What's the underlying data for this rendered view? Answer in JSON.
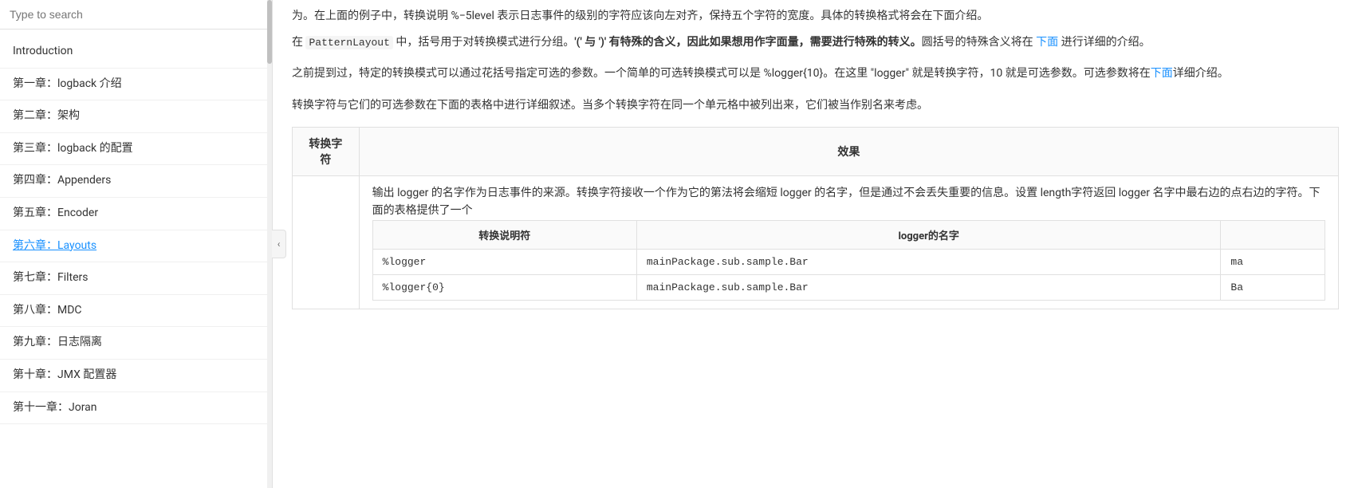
{
  "sidebar": {
    "search_placeholder": "Type to search",
    "nav_items": [
      {
        "id": "introduction",
        "label": "Introduction",
        "active": false
      },
      {
        "id": "chapter1",
        "label": "第一章：logback 介绍",
        "active": false
      },
      {
        "id": "chapter2",
        "label": "第二章：架构",
        "active": false
      },
      {
        "id": "chapter3",
        "label": "第三章：logback 的配置",
        "active": false
      },
      {
        "id": "chapter4",
        "label": "第四章：Appenders",
        "active": false
      },
      {
        "id": "chapter5",
        "label": "第五章：Encoder",
        "active": false
      },
      {
        "id": "chapter6",
        "label": "第六章：Layouts",
        "active": true
      },
      {
        "id": "chapter7",
        "label": "第七章：Filters",
        "active": false
      },
      {
        "id": "chapter8",
        "label": "第八章：MDC",
        "active": false
      },
      {
        "id": "chapter9",
        "label": "第九章：日志隔离",
        "active": false
      },
      {
        "id": "chapter10",
        "label": "第十章：JMX 配置器",
        "active": false
      },
      {
        "id": "chapter11",
        "label": "第十一章：Joran",
        "active": false
      }
    ],
    "collapse_icon": "‹"
  },
  "main": {
    "top_paragraph": "为。在上面的例子中，转换说明 %−5level 表示日志事件的级别的字符应该向左对齐，保持五个字符的宽度。具体的转换格式将会在下面介绍。",
    "paragraph1_prefix": "在 ",
    "paragraph1_code": "PatternLayout",
    "paragraph1_middle": " 中，括号用于对转换模式进行分组。",
    "paragraph1_bold": "'(' 与 ')' 有特殊的含义，因此如果想用作字面量，需要进行特殊的转义。",
    "paragraph1_suffix_prefix": "圆括号的特殊含义将在 ",
    "paragraph1_link1": "下面",
    "paragraph1_suffix": " 进行详细的介绍。",
    "paragraph2": "之前提到过，特定的转换模式可以通过花括号指定可选的参数。一个简单的可选转换模式可以是 %logger{10}。在这里 \"logger\" 就是转换字符，10 就是可选参数。可选参数将在",
    "paragraph2_link": "下面",
    "paragraph2_suffix": "详细介绍。",
    "paragraph3": "转换字符与它们的可选参数在下面的表格中进行详细叙述。当多个转换字符在同一个单元格中被列出来，它们被当作别名来考虑。",
    "table": {
      "header_col1": "转换字符",
      "header_col2": "效果",
      "row1_col2": "输出 logger 的名字作为日志事件的来源。转换字符接收一个作为它的第法将会缩短 logger 的名字，但是通过不会丢失重要的信息。设置 length字符返回 logger 名字中最右边的点右边的字符。下面的表格提供了一个",
      "inner_table": {
        "header_col1": "转换说明符",
        "header_col2": "logger的名字",
        "header_col3": "",
        "rows": [
          {
            "col1": "%logger",
            "col2": "mainPackage.sub.sample.Bar",
            "col3": "ma"
          },
          {
            "col1": "%logger{0}",
            "col2": "mainPackage.sub.sample.Bar",
            "col3": "Ba"
          }
        ]
      }
    }
  },
  "colors": {
    "active_link": "#1890ff",
    "border": "#e0e0e0",
    "table_header_bg": "#fafafa",
    "text": "#333333",
    "muted": "#999999"
  }
}
